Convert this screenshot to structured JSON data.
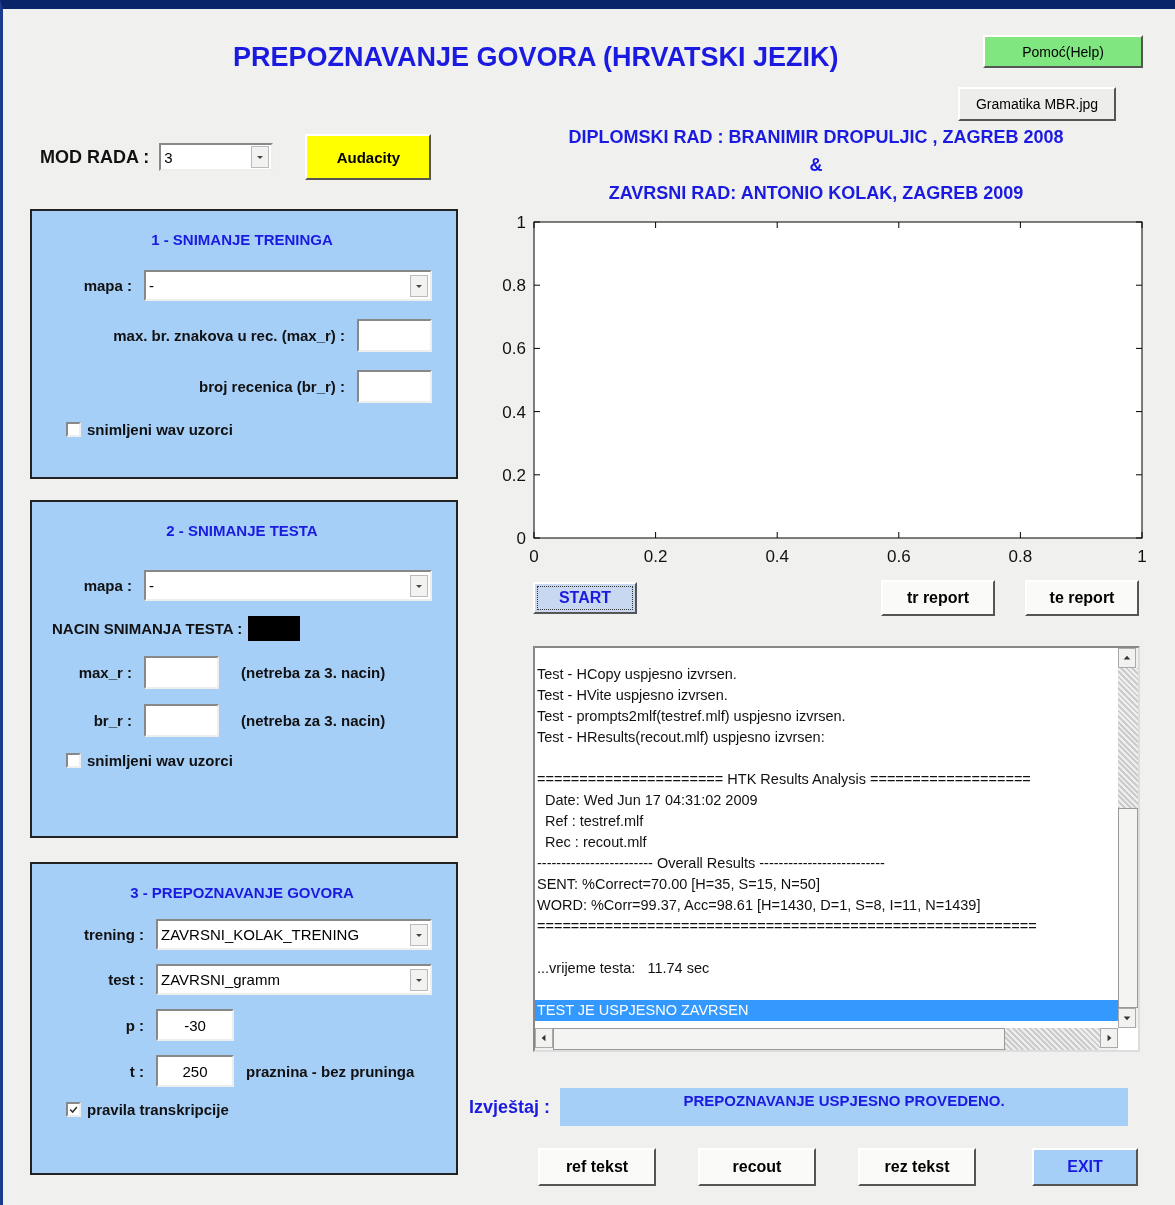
{
  "title": "PREPOZNAVANJE GOVORA (HRVATSKI JEZIK)",
  "help_button": "Pomoć(Help)",
  "grammar_button": "Gramatika MBR.jpg",
  "mode": {
    "label": "MOD RADA :",
    "value": "3"
  },
  "audacity_button": "Audacity",
  "credits": [
    "DIPLOMSKI RAD : BRANIMIR DROPULJIC , ZAGREB 2008",
    "&",
    "ZAVRSNI RAD: ANTONIO KOLAK, ZAGREB 2009"
  ],
  "panels": [
    {
      "title": "1 - SNIMANJE TRENINGA",
      "rows": [
        {
          "kind": "dropdown",
          "label": "mapa :",
          "value": "-"
        },
        {
          "kind": "field",
          "label": "max. br. znakova u rec. (max_r) :"
        },
        {
          "kind": "field",
          "label": "broj recenica (br_r) :"
        },
        {
          "kind": "checkbox",
          "label": "snimljeni wav uzorci",
          "checked": false
        }
      ]
    },
    {
      "title": "2 - SNIMANJE TESTA",
      "rows": [
        {
          "kind": "dropdown",
          "label": "mapa :",
          "value": "-"
        },
        {
          "kind": "indicator",
          "label": "NACIN SNIMANJA TESTA :"
        },
        {
          "kind": "field",
          "label": "max_r :",
          "note": "(netreba za 3. nacin)"
        },
        {
          "kind": "field",
          "label": "br_r :",
          "note": "(netreba za 3. nacin)"
        },
        {
          "kind": "checkbox",
          "label": "snimljeni wav uzorci",
          "checked": false
        }
      ]
    },
    {
      "title": "3 - PREPOZNAVANJE GOVORA",
      "rows": [
        {
          "kind": "dropdown",
          "label": "trening :",
          "value": "ZAVRSNI_KOLAK_TRENING"
        },
        {
          "kind": "dropdown",
          "label": "test :",
          "value": "ZAVRSNI_gramm"
        },
        {
          "kind": "field",
          "label": "p :",
          "value": "-30"
        },
        {
          "kind": "field",
          "label": "t :",
          "value": "250",
          "note": "praznina - bez pruninga"
        },
        {
          "kind": "checkbox",
          "label": "pravila transkripcije",
          "checked": true
        }
      ]
    }
  ],
  "chart_data": {
    "type": "line",
    "xlim": [
      0,
      1
    ],
    "ylim": [
      0,
      1
    ],
    "xticks": [
      0,
      0.2,
      0.4,
      0.6,
      0.8,
      1
    ],
    "yticks": [
      0,
      0.2,
      0.4,
      0.6,
      0.8,
      1
    ]
  },
  "start_button": "START",
  "report_buttons": [
    "tr report",
    "te report"
  ],
  "log": [
    {
      "lines": [
        {
          "text": "Test - HCopy uspjesno izvrsen.",
          "selected": false
        },
        {
          "text": "Test - HVite uspjesno izvrsen.",
          "selected": false
        },
        {
          "text": "Test - prompts2mlf(testref.mlf) uspjesno izvrsen.",
          "selected": false
        },
        {
          "text": "Test - HResults(recout.mlf) uspjesno izvrsen:",
          "selected": false
        }
      ]
    },
    {
      "lines": [
        {
          "text": "====================== HTK Results Analysis ===================",
          "selected": false
        },
        {
          "text": "  Date: Wed Jun 17 04:31:02 2009",
          "selected": false
        },
        {
          "text": "  Ref : testref.mlf",
          "selected": false
        },
        {
          "text": "  Rec : recout.mlf",
          "selected": false
        },
        {
          "text": "------------------------ Overall Results --------------------------",
          "selected": false
        },
        {
          "text": "SENT: %Correct=70.00 [H=35, S=15, N=50]",
          "selected": false
        },
        {
          "text": "WORD: %Corr=99.37, Acc=98.61 [H=1430, D=1, S=8, I=11, N=1439]",
          "selected": false
        },
        {
          "text": "===========================================================",
          "selected": false
        }
      ]
    },
    {
      "lines": [
        {
          "text": "...vrijeme testa:   11.74 sec",
          "selected": false
        }
      ]
    },
    {
      "lines": [
        {
          "text": "TEST JE USPJESNO ZAVRSEN",
          "selected": true
        }
      ]
    }
  ],
  "report": {
    "label": "Izvještaj :",
    "value": "PREPOZNAVANJE USPJESNO PROVEDENO."
  },
  "bottom_buttons": [
    {
      "label": "ref tekst",
      "kind": "plain"
    },
    {
      "label": "recout",
      "kind": "plain"
    },
    {
      "label": "rez tekst",
      "kind": "plain"
    },
    {
      "label": "EXIT",
      "kind": "exit"
    }
  ]
}
